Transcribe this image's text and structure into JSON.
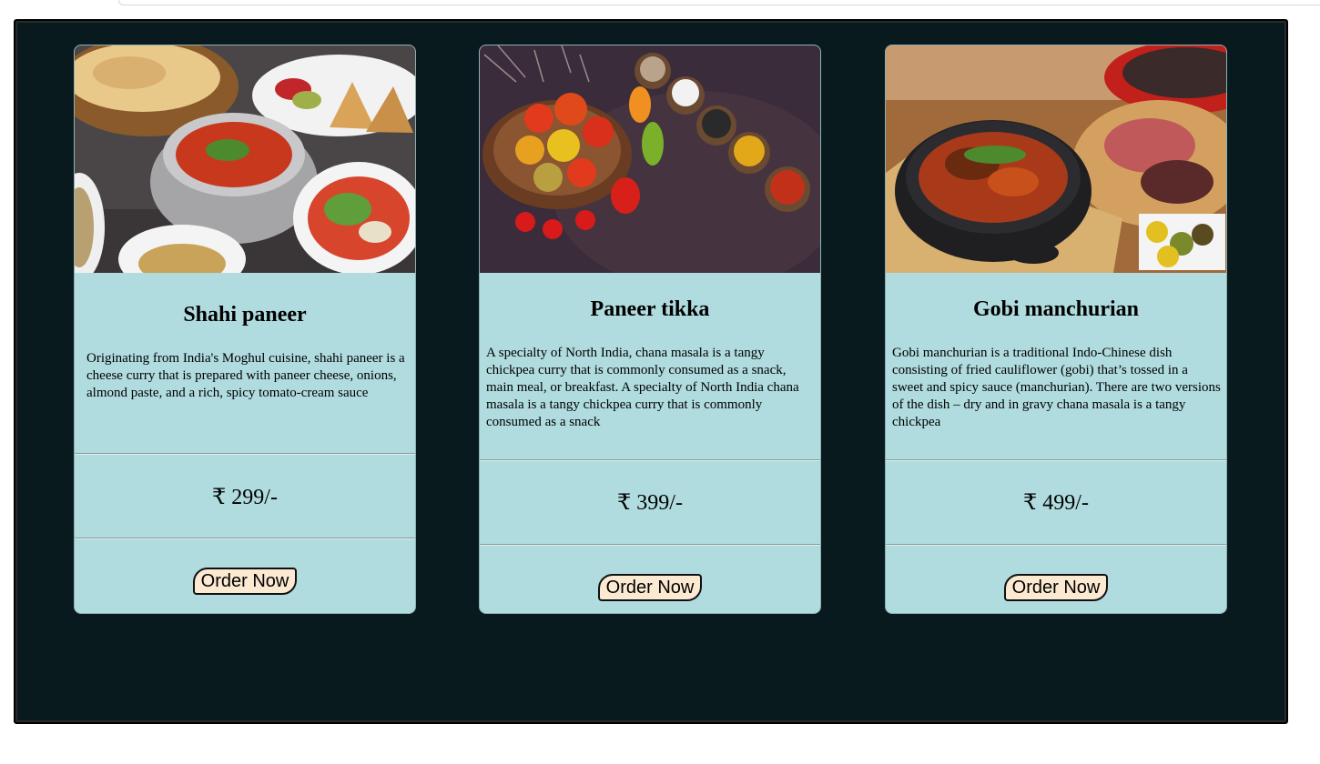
{
  "cards": [
    {
      "title": "Shahi paneer",
      "description": "Originating from India's Moghul cuisine, shahi paneer is a cheese curry that is prepared with paneer cheese, onions, almond paste, and a rich, spicy tomato-cream sauce",
      "price": "₹ 299/-",
      "button": "Order Now"
    },
    {
      "title": "Paneer tikka",
      "description": "A specialty of North India, chana masala is a tangy chickpea curry that is commonly consumed as a snack, main meal, or breakfast. A specialty of North India chana masala is a tangy chickpea curry that is commonly consumed as a snack",
      "price": "₹ 399/-",
      "button": "Order Now"
    },
    {
      "title": "Gobi manchurian",
      "description": "Gobi manchurian is a traditional Indo-Chinese dish consisting of fried cauliflower (gobi) that’s tossed in a sweet and spicy sauce (manchurian). There are two versions of the dish – dry and in gravy chana masala is a tangy chickpea",
      "price": "₹ 499/-",
      "button": "Order Now"
    }
  ],
  "colors": {
    "frame_bg": "#081a1e",
    "card_bg": "#b0dcdf",
    "button_bg": "#fbe9d1"
  }
}
